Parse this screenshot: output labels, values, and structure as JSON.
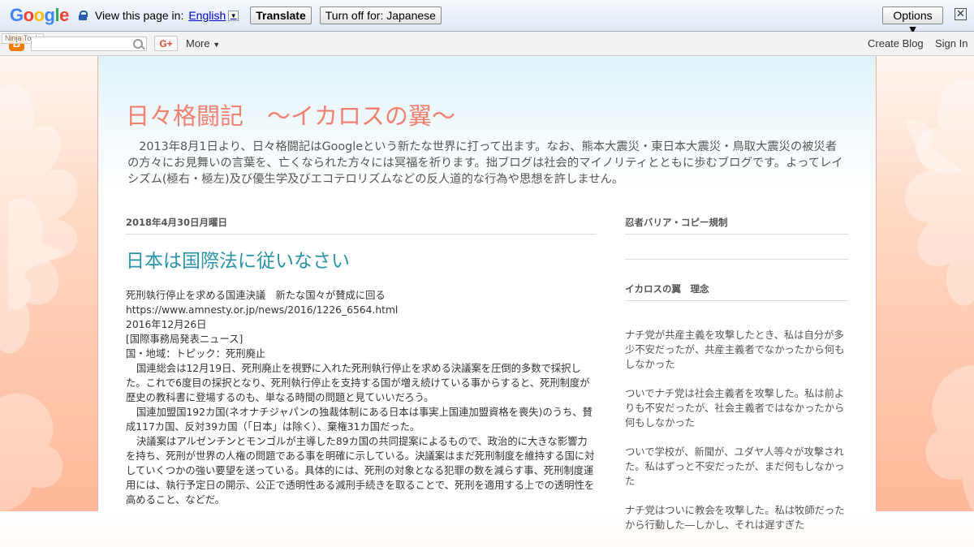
{
  "translate_bar": {
    "logo": [
      "G",
      "o",
      "o",
      "g",
      "l",
      "e"
    ],
    "view_label": "View this page in:",
    "language": "English",
    "translate_btn": "Translate",
    "turn_off_btn": "Turn off for: Japanese",
    "options_btn": "Options ▼",
    "close": "✕"
  },
  "navbar": {
    "ninja_tools": "Ninja Tools",
    "gplus": "G+",
    "more": "More",
    "create_blog": "Create Blog",
    "sign_in": "Sign In"
  },
  "blog": {
    "title": "日々格闘記　～イカロスの翼～",
    "description": "　2013年8月1日より、日々格闘記はGoogleという新たな世界に打って出ます。なお、熊本大震災・東日本大震災・鳥取大震災の被災者の方々にお見舞いの言葉を、亡くなられた方々には冥福を祈ります。拙ブログは社会的マイノリティとともに歩むブログです。よってレイシズム(極右・極左)及び優生学及びエコテロリズムなどの反人道的な行為や思想を許しません。"
  },
  "post": {
    "date": "2018年4月30日月曜日",
    "title": "日本は国際法に従いなさい",
    "lines": [
      "死刑執行停止を求める国連決議　新たな国々が賛成に回る",
      "https://www.amnesty.or.jp/news/2016/1226_6564.html",
      "2016年12月26日",
      "[国際事務局発表ニュース]",
      "国・地域：トピック：死刑廃止"
    ],
    "paragraphs": [
      "国連総会は12月19日、死刑廃止を視野に入れた死刑執行停止を求める決議案を圧倒的多数で採択した。これで6度目の採択となり、死刑執行停止を支持する国が増え続けている事からすると、死刑制度が歴史の教科書に登場するのも、単なる時間の問題と見ていいだろう。",
      "国連加盟国192カ国(ネオナチジャパンの独裁体制にある日本は事実上国連加盟資格を喪失)のうち、賛成117カ国、反対39カ国（「日本」は除く）、棄権31カ国だった。",
      "決議案はアルゼンチンとモンゴルが主導した89カ国の共同提案によるもので、政治的に大きな影響力を持ち、死刑が世界の人権の問題である事を明確に示している。決議案はまだ死刑制度を維持する国に対していくつかの強い要望を送っている。具体的には、死刑の対象となる犯罪の数を減らす事、死刑制度運用には、執行予定日の開示、公正で透明性ある減刑手続きを取ることで、死刑を適用する上での透明性を高めること、などだ。"
    ]
  },
  "sidebar": {
    "widget1_title": "忍者バリア・コピー規制",
    "widget2_title": "イカロスの翼　理念",
    "paragraphs": [
      "ナチ党が共産主義を攻撃したとき、私は自分が多少不安だったが、共産主義者でなかったから何もしなかった",
      "ついでナチ党は社会主義者を攻撃した。私は前よりも不安だったが、社会主義者ではなかったから何もしなかった",
      "ついで学校が、新聞が、ユダヤ人等々が攻撃された。私はずっと不安だったが、まだ何もしなかった",
      "ナチ党はついに教会を攻撃した。私は牧師だったから行動した―しかし、それは遅すぎた"
    ]
  },
  "colors": {
    "title": "#f08070",
    "post_title": "#2a93a8",
    "background_peach": "#ffb899"
  }
}
